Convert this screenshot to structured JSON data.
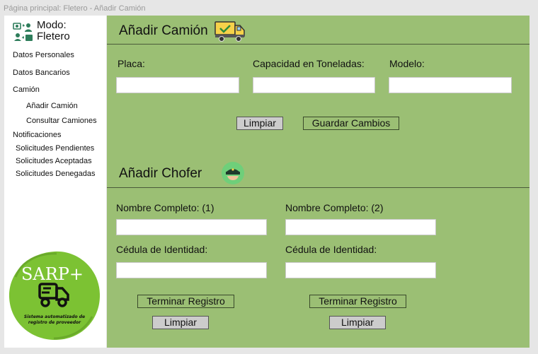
{
  "window": {
    "title": "Página principal: Fletero - Añadir Camión"
  },
  "sidebar": {
    "brand": {
      "line1": "Modo:",
      "line2": "Fletero"
    },
    "items": [
      {
        "label": "Datos Personales"
      },
      {
        "label": "Datos Bancarios"
      },
      {
        "label": "Camión"
      },
      {
        "label": "Añadir Camión"
      },
      {
        "label": "Consultar Camiones"
      },
      {
        "label": "Notificaciones"
      },
      {
        "label": "Solicitudes Pendientes"
      },
      {
        "label": "Solicitudes Aceptadas"
      },
      {
        "label": "Solicitudes Denegadas"
      }
    ],
    "logo": {
      "title": "SARP+",
      "tagline_line1": "Sistema automatizado de",
      "tagline_line2": "registro de proveedor"
    }
  },
  "truck_section": {
    "title": "Añadir Camión",
    "fields": {
      "placa": {
        "label": "Placa:",
        "value": ""
      },
      "capacidad": {
        "label": "Capacidad en Toneladas:",
        "value": ""
      },
      "modelo": {
        "label": "Modelo:",
        "value": ""
      }
    },
    "clear_button": "Limpiar",
    "save_button": "Guardar Cambios"
  },
  "driver_section": {
    "title": "Añadir Chofer",
    "driver1": {
      "name_label": "Nombre Completo: (1)",
      "id_label": "Cédula de Identidad:",
      "name_value": "",
      "id_value": "",
      "finish_button": "Terminar Registro",
      "clear_button": "Limpiar"
    },
    "driver2": {
      "name_label": "Nombre Completo: (2)",
      "id_label": "Cédula de Identidad:",
      "name_value": "",
      "id_value": "",
      "finish_button": "Terminar Registro",
      "clear_button": "Limpiar"
    }
  },
  "colors": {
    "main_bg": "#9bbf74",
    "sidebar_bg": "#ffffff",
    "logo_green": "#7cc233",
    "button_grey": "#cccccc"
  },
  "icons": {
    "brand": "people-exchange-icon",
    "truck_title": "truck-check-icon",
    "driver_title": "driver-cap-icon",
    "logo_truck": "delivery-truck-icon"
  }
}
